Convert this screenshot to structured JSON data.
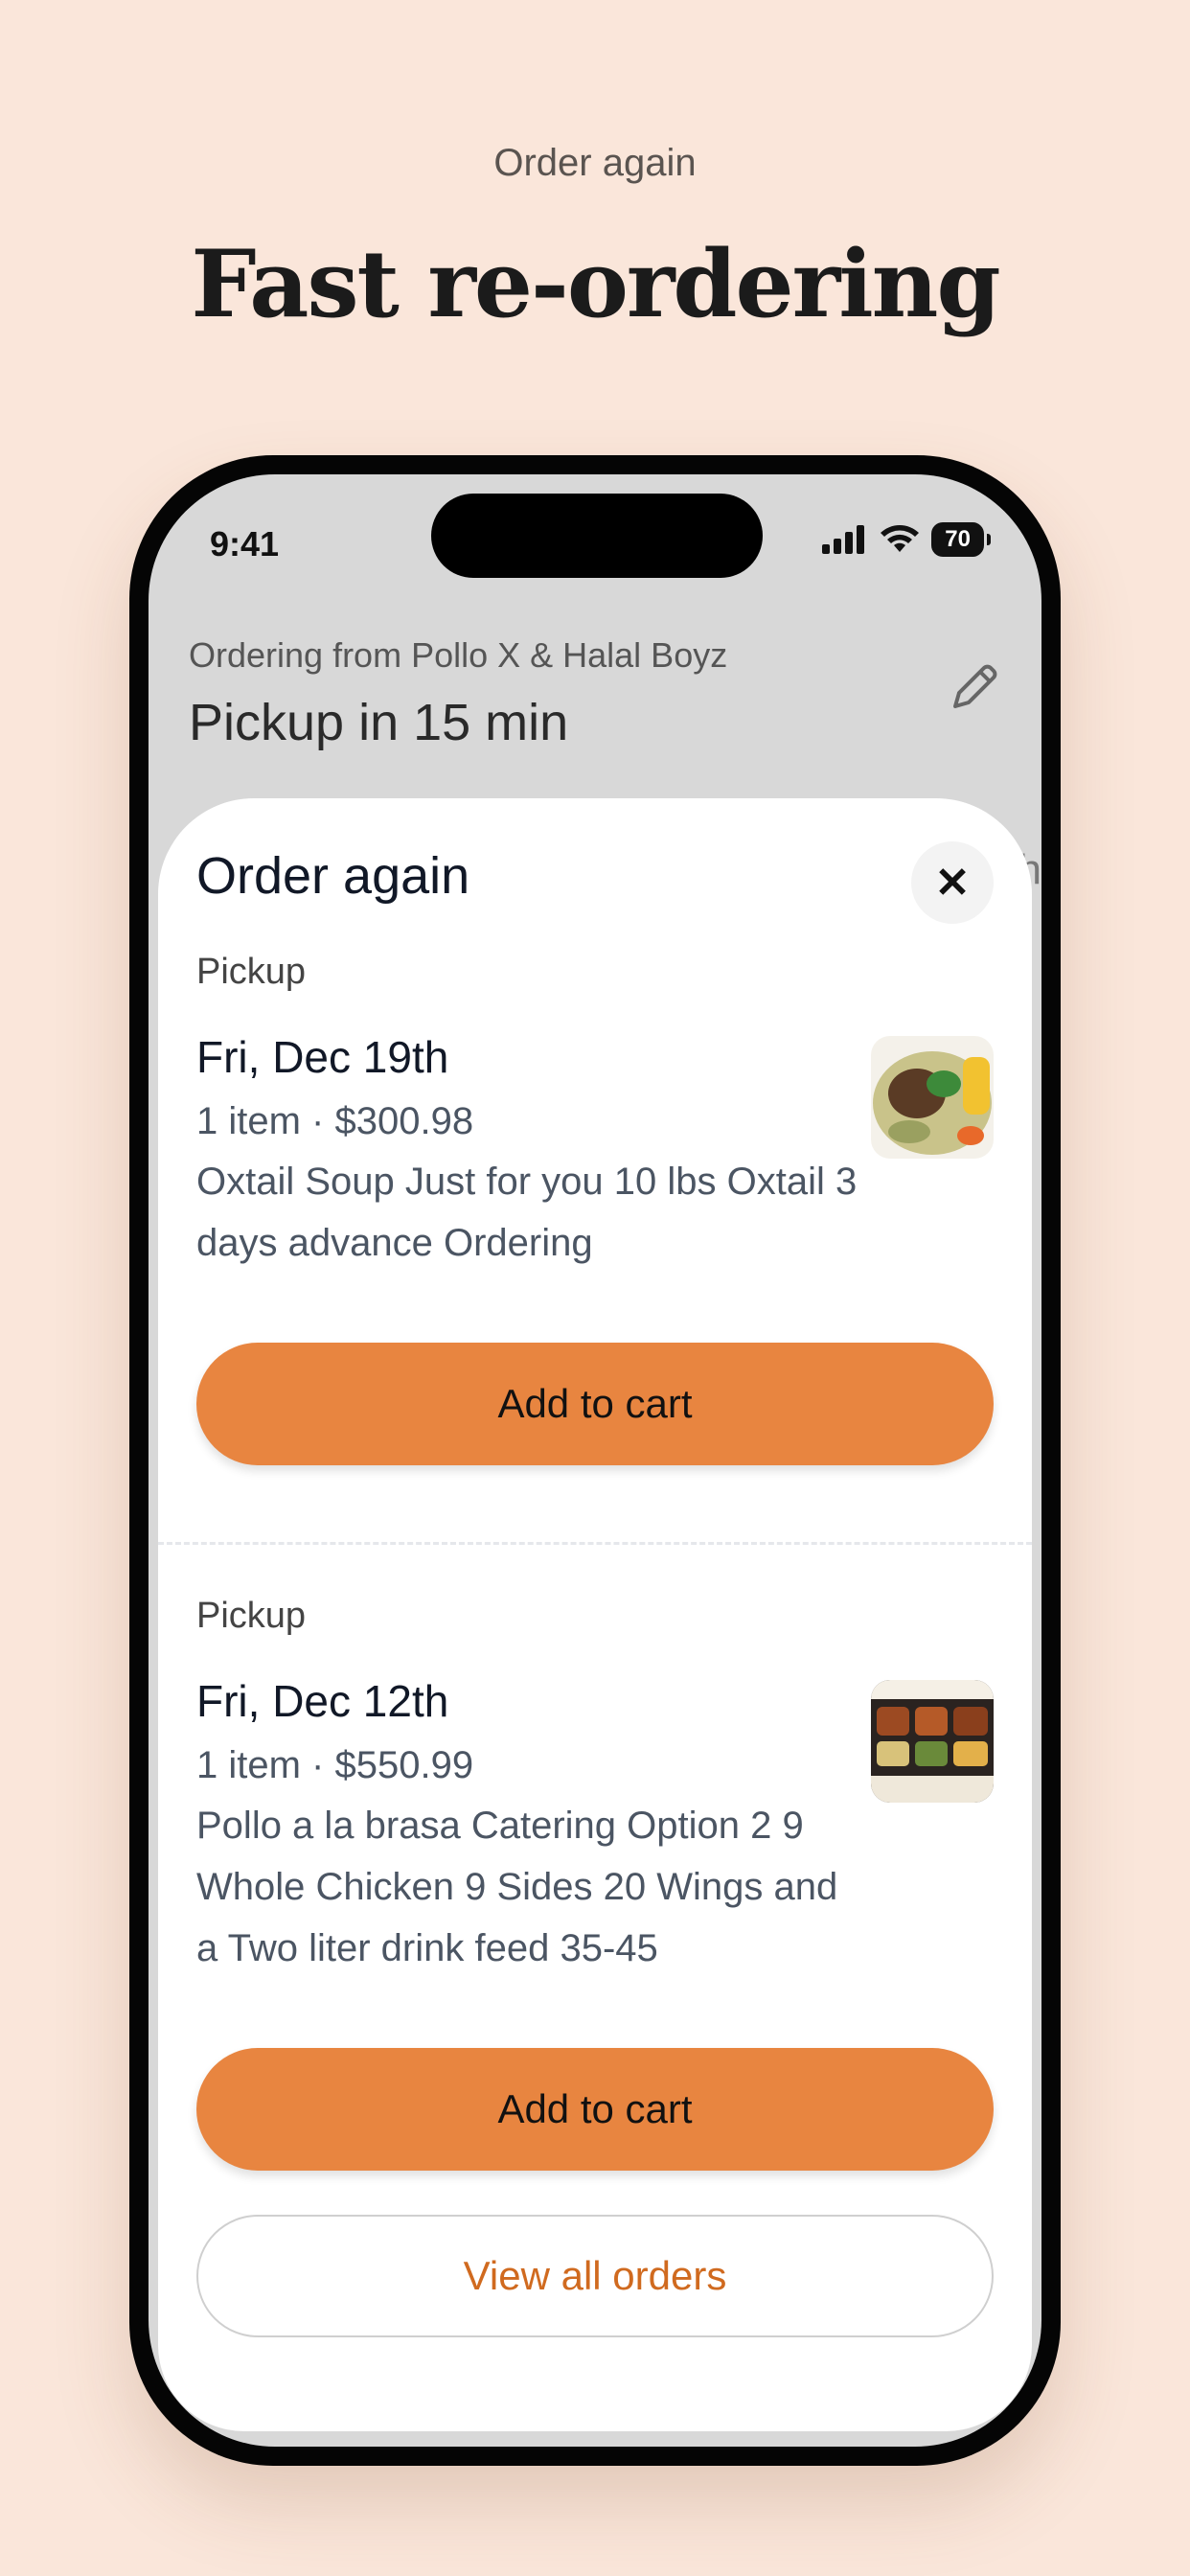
{
  "header": {
    "eyebrow": "Order again",
    "headline": "Fast re-ordering"
  },
  "status_bar": {
    "time": "9:41",
    "battery": "70",
    "icons": [
      "signal-icon",
      "wifi-icon",
      "battery-icon"
    ]
  },
  "background_screen": {
    "ordering_from": "Ordering from Pollo X & Halal Boyz",
    "pickup_time": "Pickup in 15 min"
  },
  "sheet": {
    "title": "Order again",
    "close_icon": "close-icon",
    "orders": [
      {
        "mode": "Pickup",
        "date": "Fri, Dec 19th",
        "summary": "1 item · $300.98",
        "description": "Oxtail Soup Just for you 10 lbs Oxtail 3 days advance Ordering",
        "button": "Add to cart"
      },
      {
        "mode": "Pickup",
        "date": "Fri, Dec 12th",
        "summary": "1 item · $550.99",
        "description": "Pollo a la brasa Catering Option 2 9 Whole Chicken 9 Sides 20 Wings and a Two liter drink feed 35-45",
        "button": "Add to cart"
      }
    ],
    "view_all": "View all orders"
  },
  "colors": {
    "page_bg": "#fae6da",
    "accent": "#e88540",
    "link": "#d06a1f"
  }
}
